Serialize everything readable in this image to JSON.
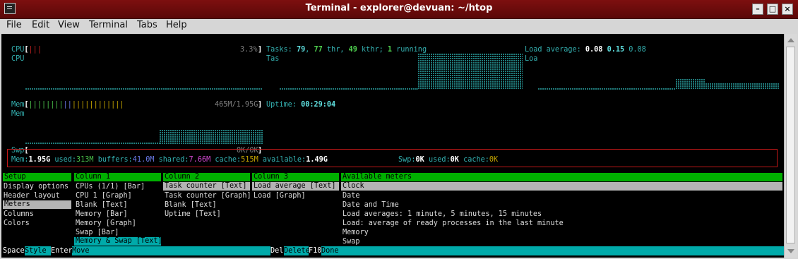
{
  "window": {
    "title": "Terminal - explorer@devuan: ~/htop"
  },
  "menubar": {
    "items": [
      "File",
      "Edit",
      "View",
      "Terminal",
      "Tabs",
      "Help"
    ]
  },
  "header": {
    "cpu": {
      "label": "CPU",
      "bar_open": "[",
      "bar_ticks": "|||",
      "percent": "3.3%",
      "bar_close": "]",
      "graph_label": "CPU"
    },
    "tasks": {
      "label": "Tasks:",
      "count": "79",
      "sep": ",",
      "threads": "77",
      "thr_label": "thr,",
      "kthreads": "49",
      "kthr_label": "kthr;",
      "running": "1",
      "running_label": "running",
      "graph_label": "Tas"
    },
    "load": {
      "label": "Load average:",
      "one": "0.08",
      "five": "0.15",
      "fifteen": "0.08",
      "graph_label": "Loa"
    },
    "mem": {
      "label": "Mem",
      "bar_open": "[",
      "bar_ticks_green": "||||||||",
      "bar_ticks_blue": "||",
      "bar_ticks_yellow": "||||||||||||",
      "value": "465M/1.95G",
      "bar_close": "]",
      "graph_label": "Mem"
    },
    "uptime": {
      "label": "Uptime:",
      "value": "00:29:04"
    },
    "swp": {
      "label": "Swp",
      "bar_open": "[",
      "value": "0K/0K",
      "bar_close": "]"
    },
    "memswap": {
      "mem_label": "Mem:",
      "mem_total": "1.95G",
      "used_label": "used:",
      "used": "313M",
      "buffers_label": "buffers:",
      "buffers": "41.0M",
      "shared_label": "shared:",
      "shared": "7.66M",
      "cache_label": "cache:",
      "cache": "515M",
      "available_label": "available:",
      "available": "1.49G",
      "swp_label": "Swp:",
      "swp_total": "0K",
      "swp_used_label": "used:",
      "swp_used": "0K",
      "swp_cache_label": "cache:",
      "swp_cache": "0K"
    }
  },
  "setup": {
    "categories_header": "Setup",
    "categories": [
      "Display options",
      "Header layout",
      "Meters",
      "Columns",
      "Colors"
    ],
    "column1": {
      "header": "Column 1",
      "items": [
        "CPUs (1/1) [Bar]",
        "CPU 1 [Graph]",
        "Blank [Text]",
        "Memory [Bar]",
        "Memory [Graph]",
        "Swap [Bar]",
        "Memory & Swap [Text]"
      ]
    },
    "column2": {
      "header": "Column 2",
      "items": [
        "Task counter [Text]",
        "Task counter [Graph]",
        "Blank [Text]",
        "Uptime [Text]"
      ]
    },
    "column3": {
      "header": "Column 3",
      "items": [
        "Load average [Text]",
        "Load [Graph]"
      ]
    },
    "available": {
      "header": "Available meters",
      "items": [
        "Clock",
        "Date",
        "Date and Time",
        "Load averages: 1 minute, 5 minutes, 15 minutes",
        "Load: average of ready processes in the last minute",
        "Memory",
        "Swap"
      ]
    }
  },
  "function_bar": [
    {
      "key": "Space",
      "label": "Style"
    },
    {
      "key": "Enter",
      "label": "Move"
    },
    {
      "key": "Del",
      "label": "Delete"
    },
    {
      "key": "F10",
      "label": "Done"
    }
  ]
}
